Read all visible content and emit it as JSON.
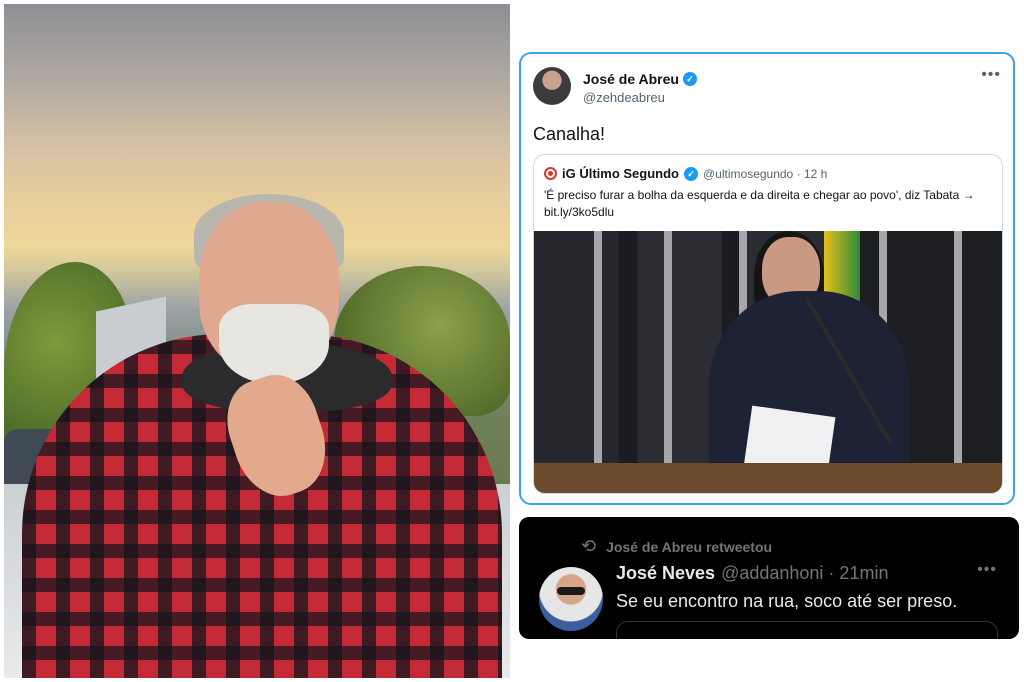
{
  "left_photo": {
    "description_icon": "portrait-photo"
  },
  "tweet": {
    "author_name": "José de Abreu",
    "author_handle": "@zehdeabreu",
    "text": "Canalha!",
    "verified_icon": "verified-badge-icon",
    "more_icon": "more-options-icon",
    "quote": {
      "name": "iG Último Segundo",
      "handle": "@ultimosegundo · 12 h",
      "text": "'É preciso furar a bolha da esquerda e da direita e chegar ao povo', diz Tabata → bit.ly/3ko5dlu"
    }
  },
  "retweet": {
    "retweeted_by": "José de Abreu retweetou",
    "author_name": "José Neves",
    "author_meta": "@addanhoni · 21min",
    "text": "Se eu encontro na rua, soco até ser preso.",
    "retweet_icon": "retweet-icon"
  },
  "colors": {
    "card_border": "#3aa3e3",
    "verified": "#1d9bf0",
    "dark_bg": "#000000"
  }
}
